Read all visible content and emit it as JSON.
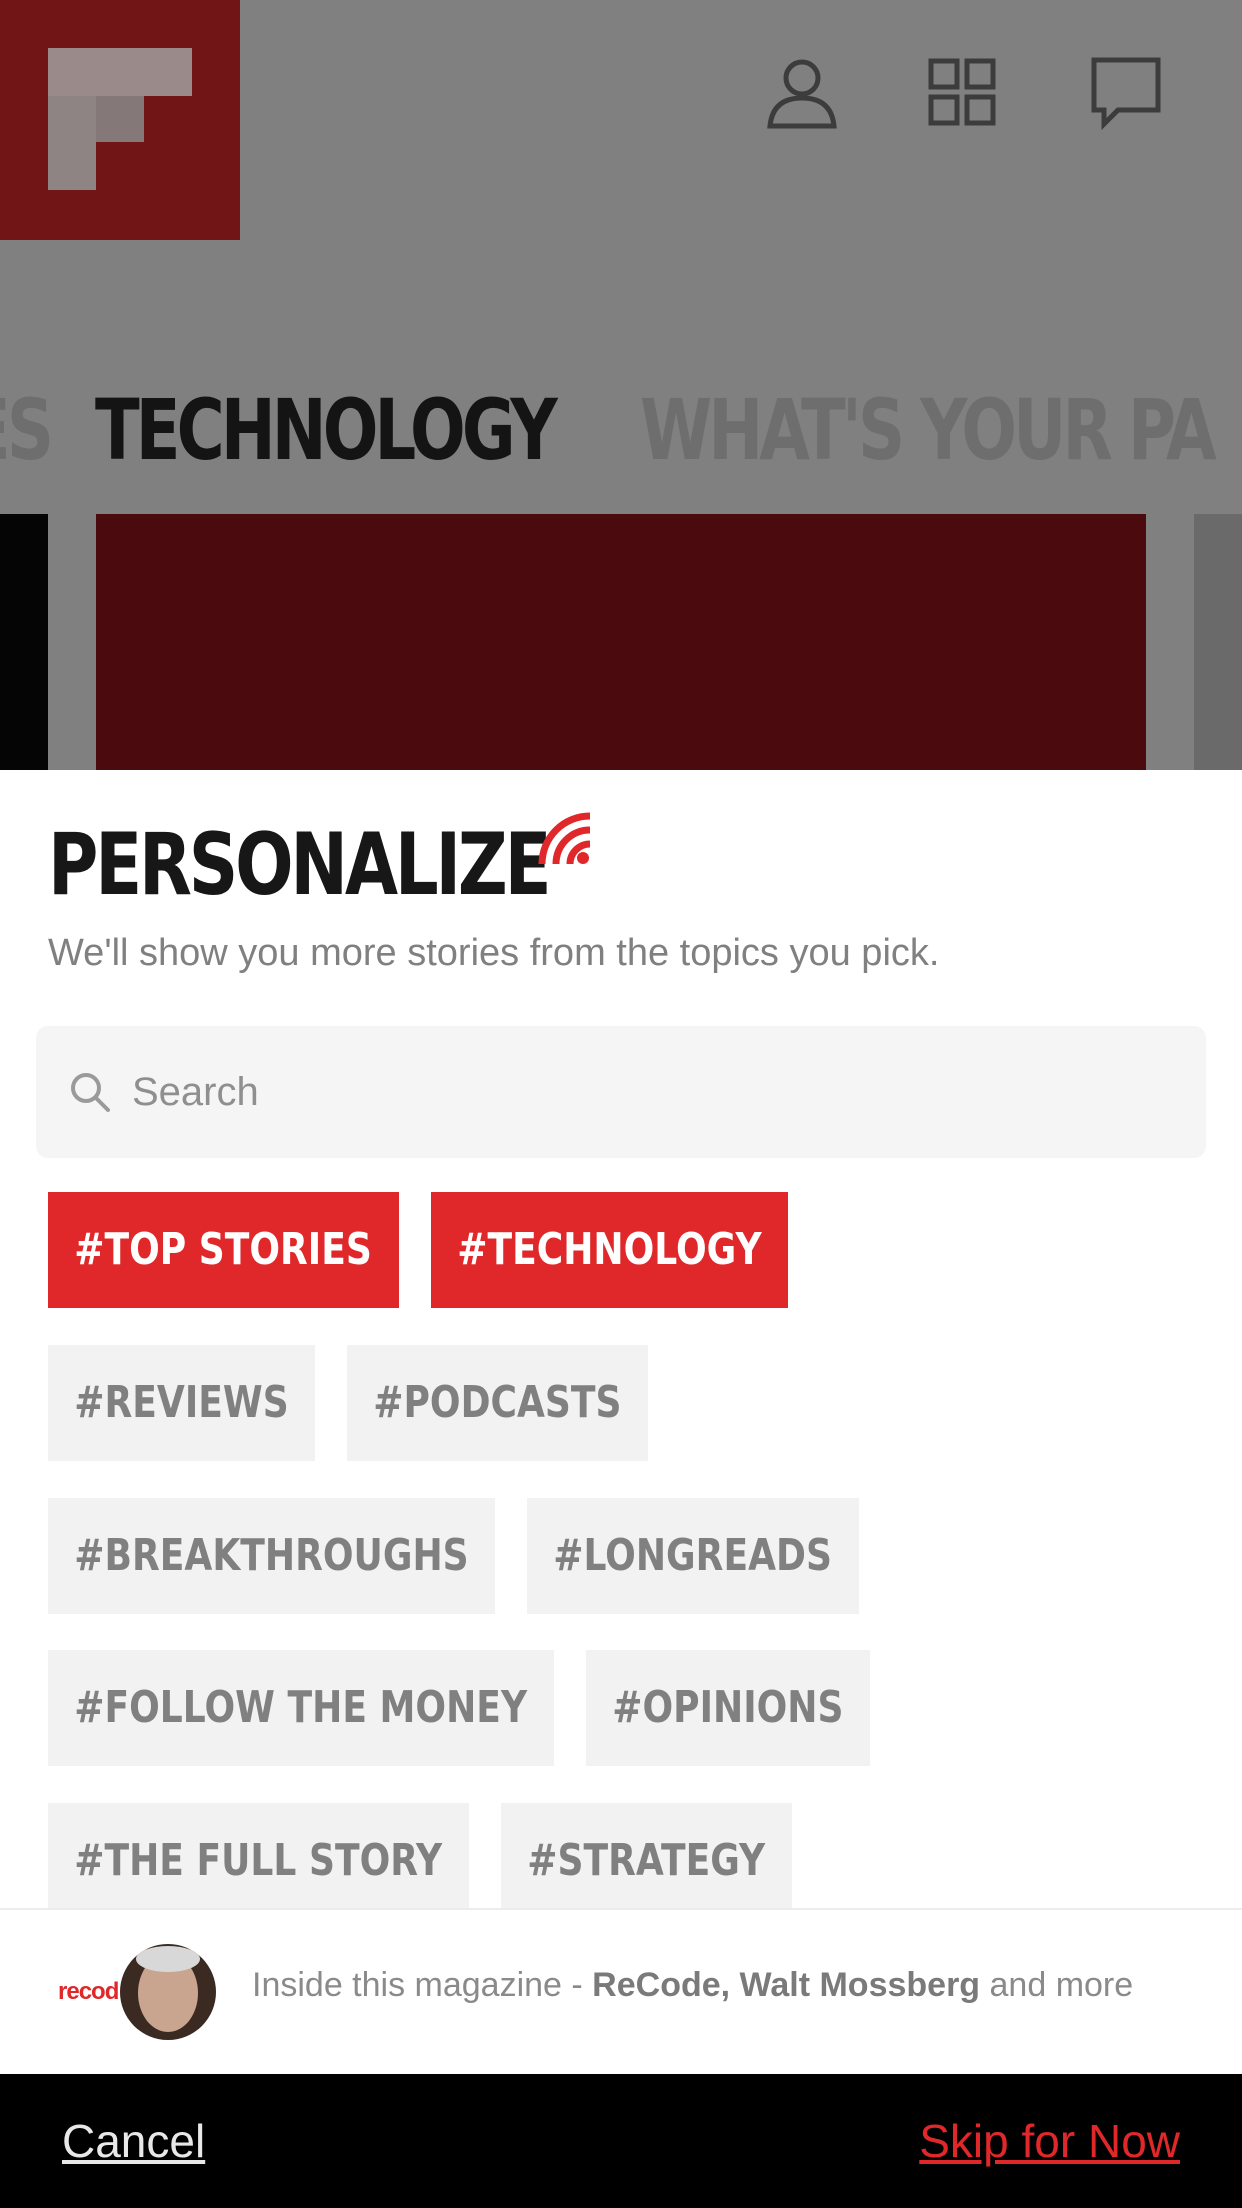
{
  "background": {
    "tabs": [
      "ES",
      "TECHNOLOGY",
      "WHAT'S YOUR PA"
    ],
    "active_tab_index": 1
  },
  "sheet": {
    "title": "PERSONALIZE",
    "subtitle": "We'll show you more stories from the topics you pick.",
    "search": {
      "placeholder": "Search"
    },
    "tag_rows": [
      [
        {
          "label": "#TOP STORIES",
          "selected": true
        },
        {
          "label": "#TECHNOLOGY",
          "selected": true
        }
      ],
      [
        {
          "label": "#REVIEWS",
          "selected": false
        },
        {
          "label": "#PODCASTS",
          "selected": false
        }
      ],
      [
        {
          "label": "#BREAKTHROUGHS",
          "selected": false
        },
        {
          "label": "#LONGREADS",
          "selected": false
        }
      ],
      [
        {
          "label": "#FOLLOW THE MONEY",
          "selected": false
        },
        {
          "label": "#OPINIONS",
          "selected": false
        }
      ],
      [
        {
          "label": "#THE FULL STORY",
          "selected": false
        },
        {
          "label": "#STRATEGY",
          "selected": false
        }
      ]
    ],
    "magazine": {
      "brand": "recod",
      "prefix": "Inside this magazine - ",
      "sources": "ReCode, Walt Mossberg",
      "suffix": " and more"
    }
  },
  "footer": {
    "cancel_label": "Cancel",
    "skip_label": "Skip for Now"
  },
  "colors": {
    "accent": "#e0282a",
    "logo": "#711516",
    "overlay": "#808080"
  },
  "icons": [
    "flipboard-logo",
    "profile-icon",
    "grid-icon",
    "chat-icon",
    "rss-icon",
    "search-icon"
  ]
}
